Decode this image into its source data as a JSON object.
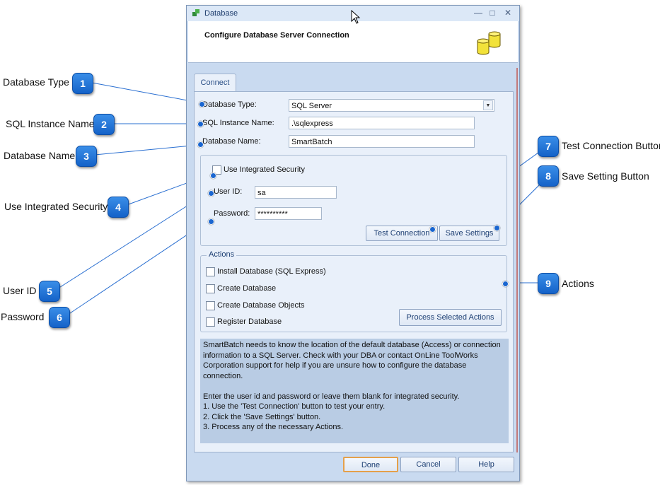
{
  "window": {
    "title": "Database",
    "header_title": "Configure Database Server Connection",
    "tab_label": "Connect"
  },
  "form": {
    "database_type_label": "Database Type:",
    "database_type_value": "SQL Server",
    "sql_instance_label": "SQL Instance Name:",
    "sql_instance_value": ".\\sqlexpress",
    "database_name_label": "Database Name:",
    "database_name_value": "SmartBatch",
    "use_integrated_security_label": "Use Integrated Security",
    "user_id_label": "User ID:",
    "user_id_value": "sa",
    "password_label": "Password:",
    "password_value": "**********",
    "test_connection_label": "Test Connection",
    "save_settings_label": "Save Settings"
  },
  "actions": {
    "legend": "Actions",
    "items": [
      "Install Database (SQL Express)",
      "Create Database",
      "Create Database Objects",
      "Register Database"
    ],
    "process_label": "Process Selected Actions"
  },
  "info_text": "SmartBatch needs to know the location of the default database (Access) or connection information to a SQL Server. Check with your DBA or contact OnLine ToolWorks Corporation support for help if you are unsure how to configure the database connection.\n\nEnter the user id and password or leave them blank for integrated security.\n1.  Use the 'Test Connection' button to test your entry.\n2.  Click the 'Save Settings' button.\n3.  Process any of the necessary Actions.",
  "footer": {
    "done_label": "Done",
    "cancel_label": "Cancel",
    "help_label": "Help"
  },
  "callouts": [
    {
      "number": "1",
      "label": "Database Type"
    },
    {
      "number": "2",
      "label": "SQL Instance Name"
    },
    {
      "number": "3",
      "label": "Database Name"
    },
    {
      "number": "4",
      "label": "Use Integrated Security"
    },
    {
      "number": "5",
      "label": "User ID"
    },
    {
      "number": "6",
      "label": "Password"
    },
    {
      "number": "7",
      "label": "Test Connection Button"
    },
    {
      "number": "8",
      "label": "Save Setting Button"
    },
    {
      "number": "9",
      "label": "Actions"
    }
  ],
  "colors": {
    "badge": "#1a6ad6",
    "window_bg": "#c9daf0",
    "info_bg": "#b9cce4"
  }
}
